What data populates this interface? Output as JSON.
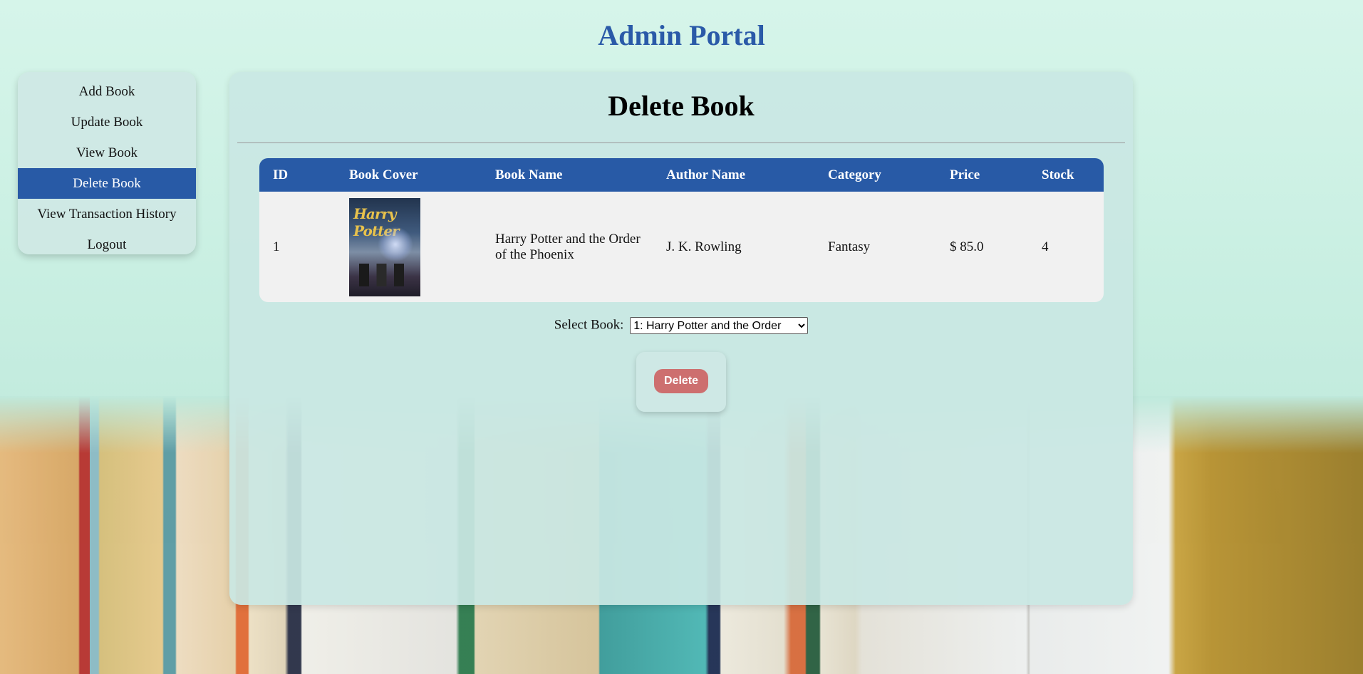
{
  "header": {
    "title": "Admin Portal"
  },
  "sidebar": {
    "items": [
      {
        "label": "Add Book"
      },
      {
        "label": "Update Book"
      },
      {
        "label": "View Book"
      },
      {
        "label": "Delete Book",
        "active": true
      },
      {
        "label": "View Transaction History"
      },
      {
        "label": "Logout"
      }
    ]
  },
  "main": {
    "title": "Delete Book",
    "table": {
      "columns": [
        "ID",
        "Book Cover",
        "Book Name",
        "Author Name",
        "Category",
        "Price",
        "Stock"
      ],
      "rows": [
        {
          "id": "1",
          "cover_title": "Harry Potter",
          "book_name": "Harry Potter and the Order of the Phoenix",
          "author": "J. K. Rowling",
          "category": "Fantasy",
          "price": "$ 85.0",
          "stock": "4"
        }
      ]
    },
    "select": {
      "label": "Select Book:",
      "value": "1: Harry Potter and the Order"
    },
    "delete_label": "Delete"
  },
  "colors": {
    "accent": "#285aa6",
    "title": "#2a5aa8",
    "delete_button": "#cd6f6f"
  }
}
